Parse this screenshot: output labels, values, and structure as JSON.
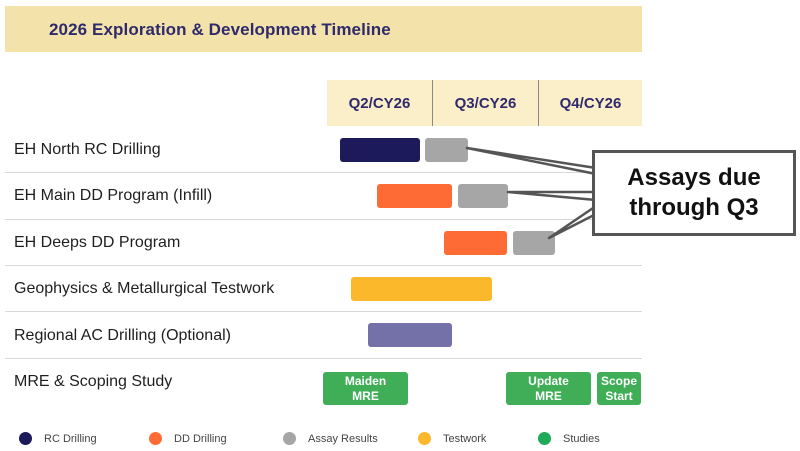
{
  "title": "2026 Exploration & Development Timeline",
  "quarters": [
    "Q2/CY26",
    "Q3/CY26",
    "Q4/CY26"
  ],
  "rows": [
    "EH North RC Drilling",
    "EH Main DD Program (Infill)",
    "EH Deeps DD Program",
    "Geophysics & Metallurgical Testwork",
    "Regional AC Drilling (Optional)",
    "MRE & Scoping Study"
  ],
  "milestones": {
    "maiden_line1": "Maiden",
    "maiden_line2": "MRE",
    "update_line1": "Update",
    "update_line2": "MRE",
    "scope_line1": "Scope",
    "scope_line2": "Start"
  },
  "callout": {
    "line1": "Assays due",
    "line2": "through Q3"
  },
  "legend": [
    {
      "label": "RC Drilling",
      "color": "#1d1a5c"
    },
    {
      "label": "DD Drilling",
      "color": "#ff6b35"
    },
    {
      "label": "Assay Results",
      "color": "#a6a6a6"
    },
    {
      "label": "Testwork",
      "color": "#fbb82b"
    },
    {
      "label": "Studies",
      "color": "#1faa5a"
    }
  ],
  "colors": {
    "rc": "#1d1a5c",
    "dd": "#ff6b35",
    "assay": "#a6a6a6",
    "testwork": "#fbb82b",
    "regional": "#7470a8",
    "studies": "#3fae57",
    "title_band": "#f3e3aa",
    "quarter_band": "#fbefc9"
  }
}
